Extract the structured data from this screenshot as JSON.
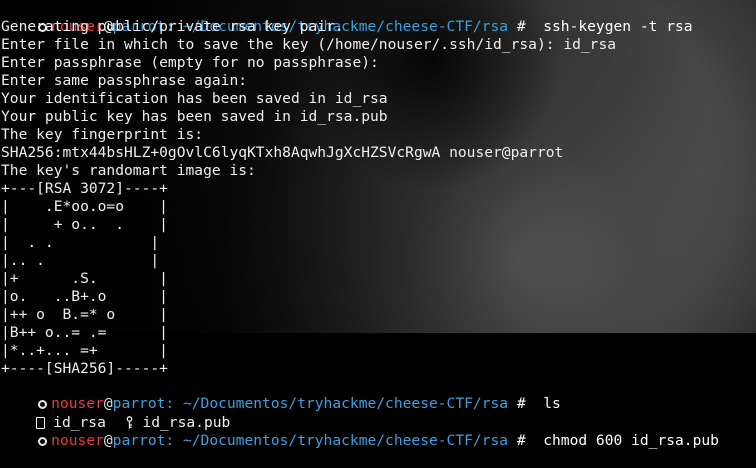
{
  "terminal": {
    "prompt": {
      "user": "nouser",
      "at": "@",
      "host": "parrot",
      "separator": ": ",
      "path": "~/Documentos/tryhackme/cheese-CTF/rsa",
      "hash": " #  "
    },
    "commands": {
      "first": "ssh-keygen -t rsa",
      "second": "ls",
      "third": "chmod 600 id_rsa.pub"
    },
    "output": [
      "Generating public/private rsa key pair.",
      "Enter file in which to save the key (/home/nouser/.ssh/id_rsa): id_rsa",
      "Enter passphrase (empty for no passphrase):",
      "Enter same passphrase again:",
      "Your identification has been saved in id_rsa",
      "Your public key has been saved in id_rsa.pub",
      "The key fingerprint is:",
      "SHA256:mtx44bsHLZ+0gOvlC6lyqKTxh8AqwhJgXcHZSVcRgwA nouser@parrot",
      "The key's randomart image is:"
    ],
    "randomart": [
      "+---[RSA 3072]----+",
      "|    .E*oo.o=o    |",
      "|     + o..  .    |",
      "|  . .           |",
      "|.. .            |",
      "|+      .S.       |",
      "|o.   ..B+.o      |",
      "|++ o  B.=* o     |",
      "|B++ o..= .=      |",
      "|*..+... =+       |",
      "+----[SHA256]-----+"
    ],
    "ls_files": [
      "id_rsa",
      "id_rsa.pub"
    ]
  }
}
